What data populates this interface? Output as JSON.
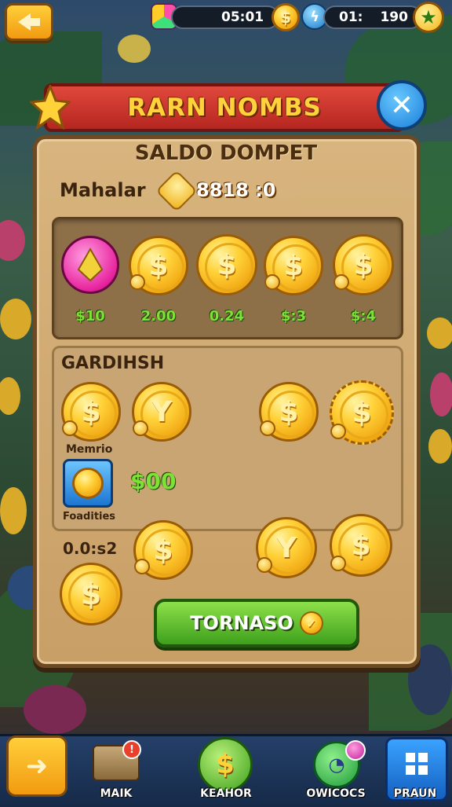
{
  "top_bar": {
    "timer_left": "05:01",
    "timer_right": "01:",
    "balance": "190"
  },
  "title": "RARN NOMBS",
  "panel": {
    "heading": "SALDO DOMPET",
    "wallet_label": "Mahalar",
    "wallet_value": "8818 :0",
    "row1_prices": [
      "$10",
      "2.00",
      "0.24",
      "$:3",
      "$:4"
    ],
    "section2_label": "GARDIHSH",
    "coin_label": "Memrio",
    "tile_label": "Foadities",
    "mid_price": "$00",
    "timer_small": "0.0:s2",
    "coin_symbols": {
      "dollar": "$",
      "yen": "Y"
    }
  },
  "cta_label": "TORNASO",
  "nav": [
    {
      "label": "MAIK",
      "icon": "chest-icon"
    },
    {
      "label": "KEAHOR",
      "icon": "dollar-coin-icon"
    },
    {
      "label": "OWICOCS",
      "icon": "clock-orb-icon"
    },
    {
      "label": "PRAUN",
      "icon": "grid-menu-icon"
    }
  ],
  "colors": {
    "accent": "#ffd23a",
    "banner": "#c9302a",
    "cta": "#5cc026",
    "panel": "#d2ad76"
  }
}
